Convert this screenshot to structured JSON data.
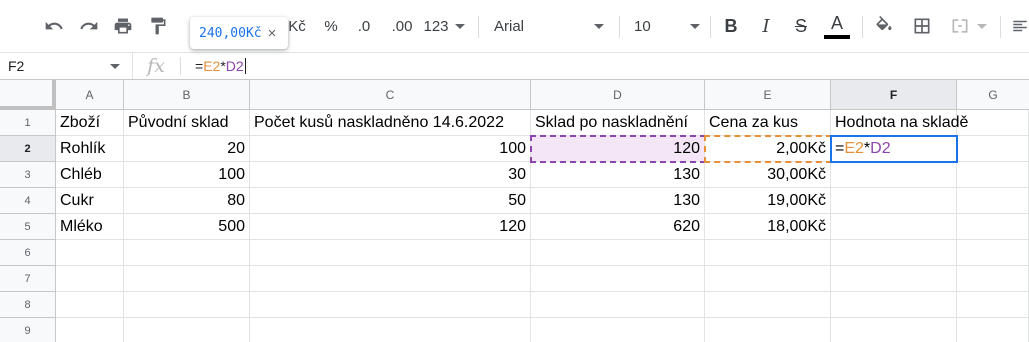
{
  "toolbar": {
    "currency_label": "Kč",
    "percent_label": "%",
    "decrease_decimals_label": ".0",
    "increase_decimals_label": ".00",
    "more_formats_label": "123",
    "font_family": "Arial",
    "font_size": "10",
    "bold_label": "B",
    "italic_label": "I",
    "strike_label": "S",
    "text_color_label": "A"
  },
  "tooltip": {
    "value": "240,00Kč",
    "close": "×"
  },
  "formula_bar": {
    "cell_ref": "F2",
    "fx_label": "fx",
    "eq": "=",
    "ref1": "E2",
    "op": "*",
    "ref2": "D2"
  },
  "columns": [
    "A",
    "B",
    "C",
    "D",
    "E",
    "F",
    "G"
  ],
  "rows": [
    "1",
    "2",
    "3",
    "4",
    "5",
    "6",
    "7",
    "8",
    "9"
  ],
  "headers": {
    "a": "Zboží",
    "b": "Původní sklad",
    "c": "Počet kusů naskladněno 14.6.2022",
    "d": "Sklad po naskladnění",
    "e": "Cena za kus",
    "f": "Hodnota na skladě"
  },
  "data_rows": [
    {
      "a": "Rohlík",
      "b": "20",
      "c": "100",
      "d": "120",
      "e": "2,00Kč"
    },
    {
      "a": "Chléb",
      "b": "100",
      "c": "30",
      "d": "130",
      "e": "30,00Kč"
    },
    {
      "a": "Cukr",
      "b": "80",
      "c": "50",
      "d": "130",
      "e": "19,00Kč"
    },
    {
      "a": "Mléko",
      "b": "500",
      "c": "120",
      "d": "620",
      "e": "18,00Kč"
    }
  ],
  "active_cell": {
    "eq": "=",
    "ref1": "E2",
    "op": "*",
    "ref2": "D2"
  },
  "colors": {
    "ref_e": "#e69138",
    "ref_d": "#8e44ad",
    "selection": "#1a73e8"
  }
}
